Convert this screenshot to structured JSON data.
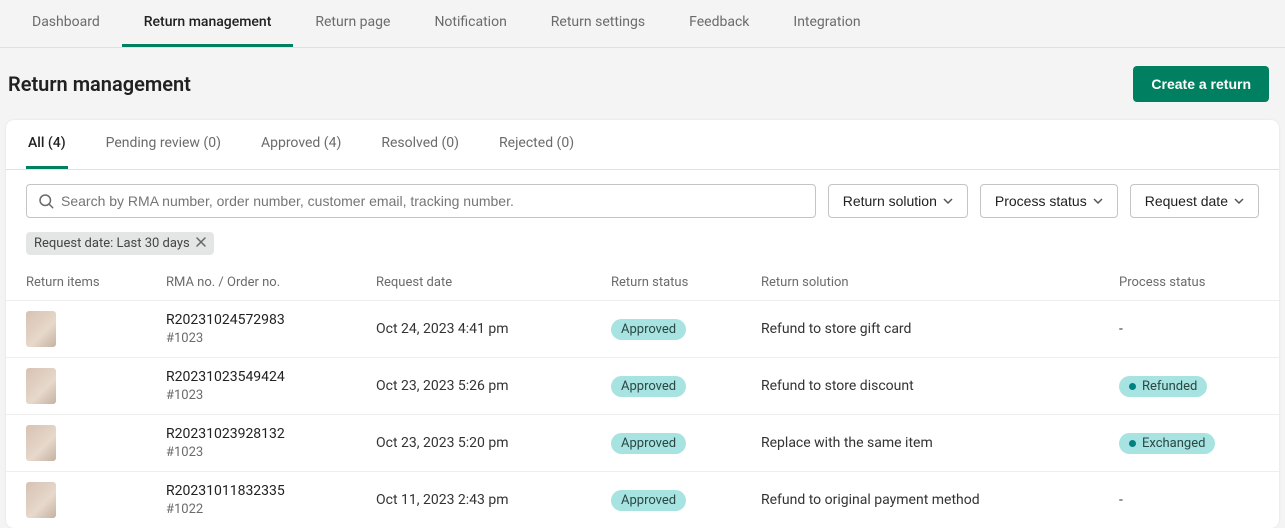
{
  "nav": {
    "items": [
      {
        "label": "Dashboard"
      },
      {
        "label": "Return management"
      },
      {
        "label": "Return page"
      },
      {
        "label": "Notification"
      },
      {
        "label": "Return settings"
      },
      {
        "label": "Feedback"
      },
      {
        "label": "Integration"
      }
    ],
    "active_index": 1
  },
  "page": {
    "title": "Return management",
    "create_button": "Create a return"
  },
  "tabs": {
    "items": [
      {
        "label": "All (4)"
      },
      {
        "label": "Pending review (0)"
      },
      {
        "label": "Approved (4)"
      },
      {
        "label": "Resolved (0)"
      },
      {
        "label": "Rejected (0)"
      }
    ],
    "active_index": 0
  },
  "search": {
    "placeholder": "Search by RMA number, order number, customer email, tracking number."
  },
  "filters": {
    "solution_label": "Return solution",
    "process_label": "Process status",
    "date_label": "Request date"
  },
  "chip": {
    "label": "Request date: Last 30 days"
  },
  "columns": {
    "items": "Return items",
    "rma": "RMA no. / Order no.",
    "date": "Request date",
    "status": "Return status",
    "solution": "Return solution",
    "process": "Process status"
  },
  "rows": [
    {
      "rma": "R20231024572983",
      "order": "#1023",
      "date": "Oct 24, 2023 4:41 pm",
      "status": "Approved",
      "solution": "Refund to store gift card",
      "process": "-"
    },
    {
      "rma": "R20231023549424",
      "order": "#1023",
      "date": "Oct 23, 2023 5:26 pm",
      "status": "Approved",
      "solution": "Refund to store discount",
      "process": "Refunded"
    },
    {
      "rma": "R20231023928132",
      "order": "#1023",
      "date": "Oct 23, 2023 5:20 pm",
      "status": "Approved",
      "solution": "Replace with the same item",
      "process": "Exchanged"
    },
    {
      "rma": "R20231011832335",
      "order": "#1022",
      "date": "Oct 11, 2023 2:43 pm",
      "status": "Approved",
      "solution": "Refund to original payment method",
      "process": "-"
    }
  ],
  "colors": {
    "accent": "#008060",
    "badge_bg": "#a7e3e0"
  }
}
